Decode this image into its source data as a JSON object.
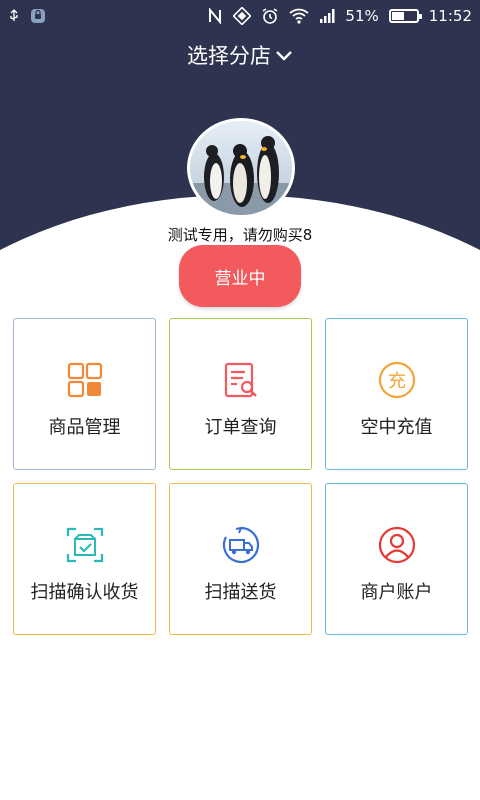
{
  "status_bar": {
    "battery": "51%",
    "battery_level": 0.51,
    "time": "11:52",
    "icons": [
      "usb-icon",
      "app-notification-icon",
      "nfc-icon",
      "rotate-lock-icon",
      "alarm-icon",
      "wifi-icon",
      "signal-icon",
      "battery-icon"
    ]
  },
  "header": {
    "title": "选择分店",
    "dropdown_icon": "chevron-down-icon"
  },
  "store": {
    "avatar": "penguin-avatar",
    "name": "测试专用，请勿购买8",
    "status": "营业中",
    "status_color": "#f25a5e"
  },
  "menu": [
    {
      "label": "商品管理",
      "icon": "product-grid-icon",
      "border": "#9fb6d9",
      "accent": "#f0883a"
    },
    {
      "label": "订单查询",
      "icon": "order-search-icon",
      "border": "#a6cc4f",
      "accent": "#f25a5e"
    },
    {
      "label": "空中充值",
      "icon": "recharge-icon",
      "border": "#66b8e0",
      "accent": "#f0a43a"
    },
    {
      "label": "扫描确认收货",
      "icon": "scan-receive-icon",
      "border": "#f2b84b",
      "accent": "#2ab8b8"
    },
    {
      "label": "扫描送货",
      "icon": "delivery-truck-icon",
      "border": "#f2b84b",
      "accent": "#3b6fd4"
    },
    {
      "label": "商户账户",
      "icon": "merchant-account-icon",
      "border": "#66b8e0",
      "accent": "#e53935"
    }
  ],
  "colors": {
    "header_bg": "#2e3350"
  }
}
